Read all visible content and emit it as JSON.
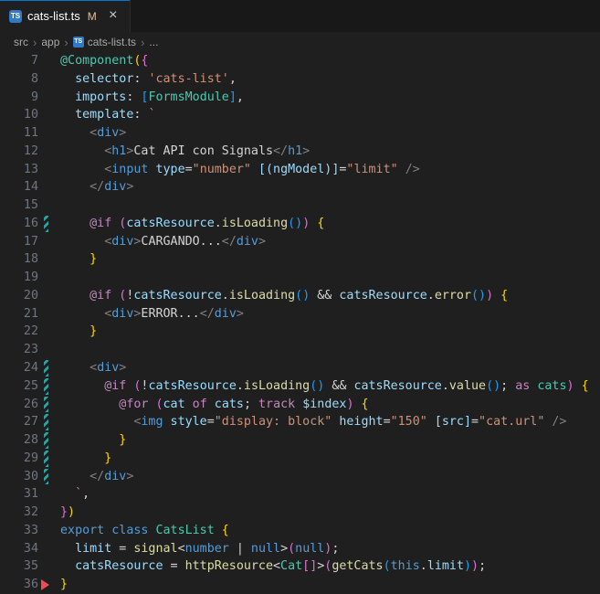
{
  "tab": {
    "icon_text": "TS",
    "label": "cats-list.ts",
    "modified_badge": "M",
    "close": "×"
  },
  "breadcrumb": {
    "separator": "›",
    "items": [
      {
        "label": "src"
      },
      {
        "label": "app"
      },
      {
        "label": "cats-list.ts",
        "icon": "TS"
      },
      {
        "label": "..."
      }
    ]
  },
  "colors": {
    "bg": "#1f1f1f",
    "tabstrip": "#181818",
    "accent": "#0078d4",
    "tsIconBg": "#3178c6",
    "modifiedBadge": "#e2c08d",
    "breadcrumbFg": "#a9a9a9",
    "lineNumber": "#6e7681",
    "fg": "#d4d4d4",
    "kw": "#569cd6",
    "ctl": "#c586c0",
    "str": "#ce9178",
    "typ": "#4ec9b0",
    "fn": "#dcdcaa",
    "var": "#9cdcfe",
    "pun": "#808080",
    "b1": "#ffd700",
    "b2": "#da70d6",
    "b3": "#179fff",
    "gitModified": "#2aa3a3",
    "gitDeleted": "#f14c4c"
  },
  "editor": {
    "modified_lines": [
      16,
      24,
      25,
      26,
      27,
      28,
      29,
      30
    ],
    "deleted_marker_line": 36,
    "lines": [
      {
        "n": 7,
        "t": [
          [
            "@Component",
            "typ"
          ],
          [
            "(",
            "b1"
          ],
          [
            "{",
            "b2"
          ]
        ]
      },
      {
        "n": 8,
        "t": [
          [
            "  ",
            "fg"
          ],
          [
            "selector",
            "var"
          ],
          [
            ": ",
            "fg"
          ],
          [
            "'cats-list'",
            "str"
          ],
          [
            ",",
            "fg"
          ]
        ]
      },
      {
        "n": 9,
        "t": [
          [
            "  ",
            "fg"
          ],
          [
            "imports",
            "var"
          ],
          [
            ": ",
            "fg"
          ],
          [
            "[",
            "b3"
          ],
          [
            "FormsModule",
            "typ"
          ],
          [
            "]",
            "b3"
          ],
          [
            ",",
            "fg"
          ]
        ]
      },
      {
        "n": 10,
        "t": [
          [
            "  ",
            "fg"
          ],
          [
            "template",
            "var"
          ],
          [
            ": ",
            "fg"
          ],
          [
            "`",
            "str"
          ]
        ]
      },
      {
        "n": 11,
        "t": [
          [
            "    ",
            "fg"
          ],
          [
            "<",
            "pun"
          ],
          [
            "div",
            "kw"
          ],
          [
            ">",
            "pun"
          ]
        ]
      },
      {
        "n": 12,
        "t": [
          [
            "      ",
            "fg"
          ],
          [
            "<",
            "pun"
          ],
          [
            "h1",
            "kw"
          ],
          [
            ">",
            "pun"
          ],
          [
            "Cat API con Signals",
            "fg"
          ],
          [
            "</",
            "pun"
          ],
          [
            "h1",
            "kw"
          ],
          [
            ">",
            "pun"
          ]
        ]
      },
      {
        "n": 13,
        "t": [
          [
            "      ",
            "fg"
          ],
          [
            "<",
            "pun"
          ],
          [
            "input",
            "kw"
          ],
          [
            " ",
            "fg"
          ],
          [
            "type",
            "var"
          ],
          [
            "=",
            "fg"
          ],
          [
            "\"number\"",
            "str"
          ],
          [
            " ",
            "fg"
          ],
          [
            "[(ngModel)]",
            "var"
          ],
          [
            "=",
            "fg"
          ],
          [
            "\"limit\"",
            "str"
          ],
          [
            " />",
            "pun"
          ]
        ]
      },
      {
        "n": 14,
        "t": [
          [
            "    ",
            "fg"
          ],
          [
            "</",
            "pun"
          ],
          [
            "div",
            "kw"
          ],
          [
            ">",
            "pun"
          ]
        ]
      },
      {
        "n": 15,
        "t": []
      },
      {
        "n": 16,
        "t": [
          [
            "    ",
            "fg"
          ],
          [
            "@if",
            "ctl"
          ],
          [
            " ",
            "fg"
          ],
          [
            "(",
            "b2"
          ],
          [
            "catsResource",
            "var"
          ],
          [
            ".",
            "fg"
          ],
          [
            "isLoading",
            "fn"
          ],
          [
            "()",
            "b3"
          ],
          [
            ")",
            "b2"
          ],
          [
            " ",
            "fg"
          ],
          [
            "{",
            "b1"
          ]
        ]
      },
      {
        "n": 17,
        "t": [
          [
            "      ",
            "fg"
          ],
          [
            "<",
            "pun"
          ],
          [
            "div",
            "kw"
          ],
          [
            ">",
            "pun"
          ],
          [
            "CARGANDO...",
            "fg"
          ],
          [
            "</",
            "pun"
          ],
          [
            "div",
            "kw"
          ],
          [
            ">",
            "pun"
          ]
        ]
      },
      {
        "n": 18,
        "t": [
          [
            "    ",
            "fg"
          ],
          [
            "}",
            "b1"
          ]
        ]
      },
      {
        "n": 19,
        "t": []
      },
      {
        "n": 20,
        "t": [
          [
            "    ",
            "fg"
          ],
          [
            "@if",
            "ctl"
          ],
          [
            " ",
            "fg"
          ],
          [
            "(",
            "b2"
          ],
          [
            "!",
            "fg"
          ],
          [
            "catsResource",
            "var"
          ],
          [
            ".",
            "fg"
          ],
          [
            "isLoading",
            "fn"
          ],
          [
            "()",
            "b3"
          ],
          [
            " && ",
            "fg"
          ],
          [
            "catsResource",
            "var"
          ],
          [
            ".",
            "fg"
          ],
          [
            "error",
            "fn"
          ],
          [
            "()",
            "b3"
          ],
          [
            ")",
            "b2"
          ],
          [
            " ",
            "fg"
          ],
          [
            "{",
            "b1"
          ]
        ]
      },
      {
        "n": 21,
        "t": [
          [
            "      ",
            "fg"
          ],
          [
            "<",
            "pun"
          ],
          [
            "div",
            "kw"
          ],
          [
            ">",
            "pun"
          ],
          [
            "ERROR...",
            "fg"
          ],
          [
            "</",
            "pun"
          ],
          [
            "div",
            "kw"
          ],
          [
            ">",
            "pun"
          ]
        ]
      },
      {
        "n": 22,
        "t": [
          [
            "    ",
            "fg"
          ],
          [
            "}",
            "b1"
          ]
        ]
      },
      {
        "n": 23,
        "t": []
      },
      {
        "n": 24,
        "t": [
          [
            "    ",
            "fg"
          ],
          [
            "<",
            "pun"
          ],
          [
            "div",
            "kw"
          ],
          [
            ">",
            "pun"
          ]
        ]
      },
      {
        "n": 25,
        "t": [
          [
            "      ",
            "fg"
          ],
          [
            "@if",
            "ctl"
          ],
          [
            " ",
            "fg"
          ],
          [
            "(",
            "b2"
          ],
          [
            "!",
            "fg"
          ],
          [
            "catsResource",
            "var"
          ],
          [
            ".",
            "fg"
          ],
          [
            "isLoading",
            "fn"
          ],
          [
            "()",
            "b3"
          ],
          [
            " && ",
            "fg"
          ],
          [
            "catsResource",
            "var"
          ],
          [
            ".",
            "fg"
          ],
          [
            "value",
            "fn"
          ],
          [
            "()",
            "b3"
          ],
          [
            "; ",
            "fg"
          ],
          [
            "as",
            "ctl"
          ],
          [
            " ",
            "fg"
          ],
          [
            "cats",
            "typ"
          ],
          [
            ")",
            "b2"
          ],
          [
            " ",
            "fg"
          ],
          [
            "{",
            "b1"
          ]
        ]
      },
      {
        "n": 26,
        "t": [
          [
            "        ",
            "fg"
          ],
          [
            "@for",
            "ctl"
          ],
          [
            " ",
            "fg"
          ],
          [
            "(",
            "b2"
          ],
          [
            "cat",
            "var"
          ],
          [
            " ",
            "fg"
          ],
          [
            "of",
            "ctl"
          ],
          [
            " ",
            "fg"
          ],
          [
            "cats",
            "var"
          ],
          [
            "; ",
            "fg"
          ],
          [
            "track",
            "ctl"
          ],
          [
            " ",
            "fg"
          ],
          [
            "$index",
            "var"
          ],
          [
            ")",
            "b2"
          ],
          [
            " ",
            "fg"
          ],
          [
            "{",
            "b1"
          ]
        ]
      },
      {
        "n": 27,
        "t": [
          [
            "          ",
            "fg"
          ],
          [
            "<",
            "pun"
          ],
          [
            "img",
            "kw"
          ],
          [
            " ",
            "fg"
          ],
          [
            "style",
            "var"
          ],
          [
            "=",
            "fg"
          ],
          [
            "\"display: block\"",
            "str"
          ],
          [
            " ",
            "fg"
          ],
          [
            "height",
            "var"
          ],
          [
            "=",
            "fg"
          ],
          [
            "\"150\"",
            "str"
          ],
          [
            " ",
            "fg"
          ],
          [
            "[src]",
            "var"
          ],
          [
            "=",
            "fg"
          ],
          [
            "\"cat.url\"",
            "str"
          ],
          [
            " />",
            "pun"
          ]
        ]
      },
      {
        "n": 28,
        "t": [
          [
            "        ",
            "fg"
          ],
          [
            "}",
            "b1"
          ]
        ]
      },
      {
        "n": 29,
        "t": [
          [
            "      ",
            "fg"
          ],
          [
            "}",
            "b1"
          ]
        ]
      },
      {
        "n": 30,
        "t": [
          [
            "    ",
            "fg"
          ],
          [
            "</",
            "pun"
          ],
          [
            "div",
            "kw"
          ],
          [
            ">",
            "pun"
          ]
        ]
      },
      {
        "n": 31,
        "t": [
          [
            "  ",
            "fg"
          ],
          [
            "`",
            "str"
          ],
          [
            ",",
            "fg"
          ]
        ]
      },
      {
        "n": 32,
        "t": [
          [
            "}",
            "b2"
          ],
          [
            ")",
            "b1"
          ]
        ]
      },
      {
        "n": 33,
        "t": [
          [
            "export",
            "kw"
          ],
          [
            " ",
            "fg"
          ],
          [
            "class",
            "kw"
          ],
          [
            " ",
            "fg"
          ],
          [
            "CatsList",
            "typ"
          ],
          [
            " ",
            "fg"
          ],
          [
            "{",
            "b1"
          ]
        ]
      },
      {
        "n": 34,
        "t": [
          [
            "  ",
            "fg"
          ],
          [
            "limit",
            "var"
          ],
          [
            " = ",
            "fg"
          ],
          [
            "signal",
            "fn"
          ],
          [
            "<",
            "fg"
          ],
          [
            "number",
            "kw"
          ],
          [
            " | ",
            "fg"
          ],
          [
            "null",
            "kw"
          ],
          [
            ">",
            "fg"
          ],
          [
            "(",
            "b2"
          ],
          [
            "null",
            "kw"
          ],
          [
            ")",
            "b2"
          ],
          [
            ";",
            "fg"
          ]
        ]
      },
      {
        "n": 35,
        "t": [
          [
            "  ",
            "fg"
          ],
          [
            "catsResource",
            "var"
          ],
          [
            " = ",
            "fg"
          ],
          [
            "httpResource",
            "fn"
          ],
          [
            "<",
            "fg"
          ],
          [
            "Cat",
            "typ"
          ],
          [
            "[]",
            "b2"
          ],
          [
            ">",
            "fg"
          ],
          [
            "(",
            "b2"
          ],
          [
            "getCats",
            "fn"
          ],
          [
            "(",
            "b3"
          ],
          [
            "this",
            "kw"
          ],
          [
            ".",
            "fg"
          ],
          [
            "limit",
            "var"
          ],
          [
            ")",
            "b3"
          ],
          [
            ")",
            "b2"
          ],
          [
            ";",
            "fg"
          ]
        ]
      },
      {
        "n": 36,
        "t": [
          [
            "}",
            "b1"
          ]
        ]
      }
    ]
  }
}
